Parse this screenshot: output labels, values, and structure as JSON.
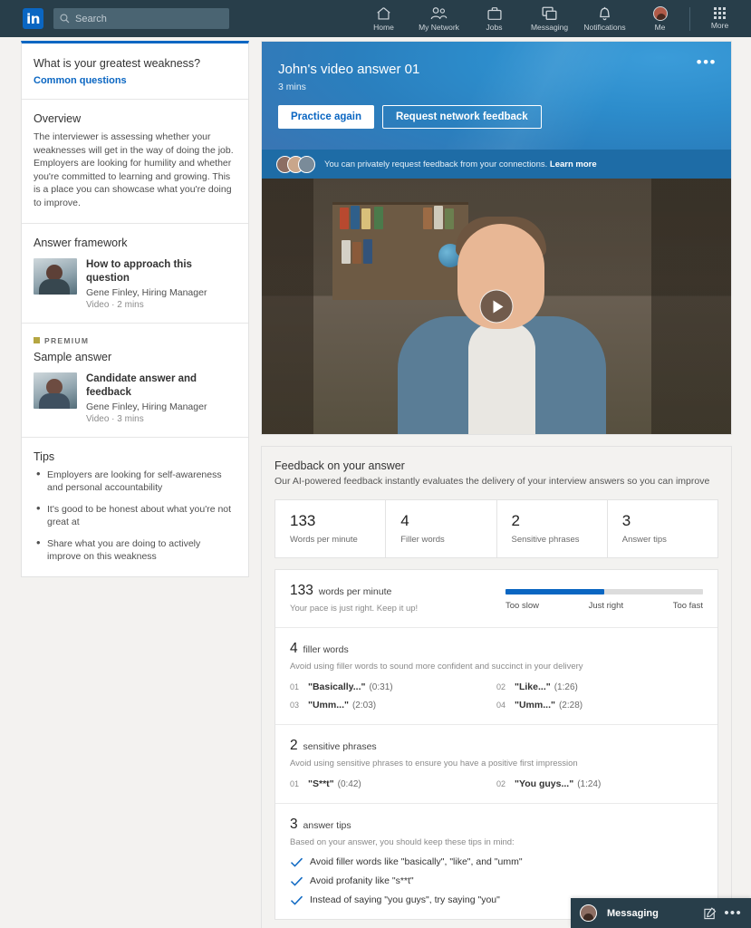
{
  "nav": {
    "logo": "in",
    "search_placeholder": "Search",
    "search_value": "",
    "items": [
      {
        "label": "Home",
        "icon": "home-icon"
      },
      {
        "label": "My Network",
        "icon": "network-icon"
      },
      {
        "label": "Jobs",
        "icon": "briefcase-icon"
      },
      {
        "label": "Messaging",
        "icon": "messaging-icon"
      },
      {
        "label": "Notifications",
        "icon": "bell-icon"
      },
      {
        "label": "Me",
        "icon": "avatar-icon"
      },
      {
        "label": "More",
        "icon": "grid-icon"
      }
    ]
  },
  "sidebar": {
    "question": "What is your greatest weakness?",
    "common_questions_link": "Common questions",
    "overview": {
      "heading": "Overview",
      "body": "The interviewer is assessing whether your weaknesses will get in the way of doing the job. Employers are looking for humility and whether you're committed to learning and growing. This is a place you can showcase what you're doing to improve."
    },
    "answer_framework": {
      "heading": "Answer framework",
      "title": "How to approach this question",
      "author": "Gene Finley, Hiring Manager",
      "meta": "Video · 2 mins"
    },
    "sample_answer": {
      "badge": "PREMIUM",
      "heading": "Sample answer",
      "title": "Candidate answer and feedback",
      "author": "Gene Finley, Hiring Manager",
      "meta": "Video · 3 mins"
    },
    "tips": {
      "heading": "Tips",
      "items": [
        "Employers are looking for self-awareness and personal accountability",
        "It's good to be honest about what you're not great at",
        "Share what you are doing to actively improve on this weakness"
      ]
    }
  },
  "video": {
    "title": "John's video answer 01",
    "duration": "3 mins",
    "practice_button": "Practice again",
    "request_button": "Request network feedback",
    "menu_icon": "more-options-icon",
    "notice_text": "You can privately request feedback from your connections.",
    "notice_link": "Learn more",
    "play_icon": "play-icon"
  },
  "feedback": {
    "title": "Feedback on your answer",
    "subtitle": "Our AI-powered feedback instantly evaluates the delivery of your interview answers so you can improve",
    "stats": [
      {
        "value": "133",
        "label": "Words per minute"
      },
      {
        "value": "4",
        "label": "Filler words"
      },
      {
        "value": "2",
        "label": "Sensitive phrases"
      },
      {
        "value": "3",
        "label": "Answer tips"
      }
    ],
    "wpm": {
      "value": "133",
      "unit": "words per minute",
      "description": "Your pace is just right. Keep it up!",
      "fill_percent": 50,
      "scale_labels": [
        "Too slow",
        "Just right",
        "Too fast"
      ]
    },
    "filler": {
      "count": "4",
      "label": "filler words",
      "description": "Avoid using filler words to sound more confident and succinct in your delivery",
      "items": [
        {
          "index": "01",
          "phrase": "\"Basically...\"",
          "time": "(0:31)"
        },
        {
          "index": "02",
          "phrase": "\"Like...\"",
          "time": "(1:26)"
        },
        {
          "index": "03",
          "phrase": "\"Umm...\"",
          "time": "(2:03)"
        },
        {
          "index": "04",
          "phrase": "\"Umm...\"",
          "time": "(2:28)"
        }
      ]
    },
    "sensitive": {
      "count": "2",
      "label": "sensitive phrases",
      "description": "Avoid using sensitive phrases to ensure you have a positive first impression",
      "items": [
        {
          "index": "01",
          "phrase": "\"S**t\"",
          "time": "(0:42)"
        },
        {
          "index": "02",
          "phrase": "\"You guys...\"",
          "time": "(1:24)"
        }
      ]
    },
    "tips": {
      "count": "3",
      "label": "answer tips",
      "description": "Based on your answer, you should keep these tips in mind:",
      "items": [
        "Avoid filler words like \"basically\", \"like\", and \"umm\"",
        "Avoid profanity like \"s**t\"",
        "Instead of saying \"you guys\", try saying \"you\""
      ]
    }
  },
  "messaging_dock": {
    "label": "Messaging",
    "compose_icon": "compose-icon",
    "more_icon": "more-options-icon"
  },
  "colors": {
    "brand_blue": "#0a66c2",
    "nav_bg": "#283e4a",
    "page_bg": "#f3f2f0",
    "premium_gold": "#b5a642"
  }
}
